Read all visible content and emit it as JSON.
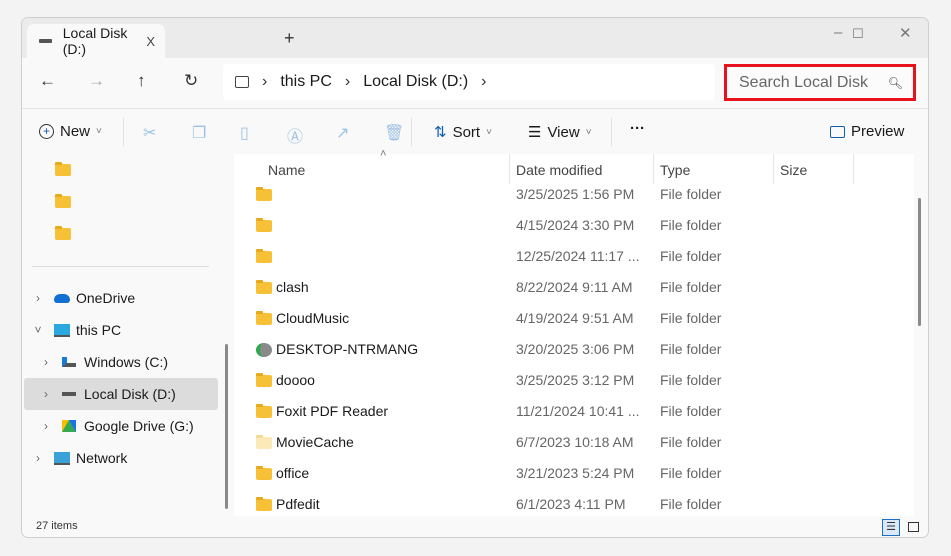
{
  "tab": {
    "title": "Local Disk (D:)",
    "close": "X",
    "new_tab": "+"
  },
  "window_controls": {
    "minimize": "–",
    "maximize": "☐",
    "close": "✕"
  },
  "nav": {
    "back": "←",
    "forward": "→",
    "up": "↑",
    "refresh": "↻"
  },
  "breadcrumb": {
    "items": [
      "this PC",
      "Local Disk (D:)"
    ],
    "sep": "›"
  },
  "search": {
    "placeholder": "Search Local Disk",
    "highlight_color": "#e8121e"
  },
  "toolbar": {
    "new": "New",
    "sort": "Sort",
    "view": "View",
    "more": "···",
    "preview": "Preview",
    "caret": "˅"
  },
  "sidebar": {
    "pinned": [
      "",
      "",
      ""
    ],
    "items": [
      {
        "label": "OneDrive",
        "icon": "onedrive-icon",
        "expanded": false
      },
      {
        "label": "this PC",
        "icon": "computer-icon",
        "expanded": true
      },
      {
        "label": "Windows (C:)",
        "icon": "windows-drive-icon",
        "expanded": false
      },
      {
        "label": "Local Disk (D:)",
        "icon": "drive-icon",
        "expanded": false,
        "selected": true
      },
      {
        "label": "Google Drive (G:)",
        "icon": "google-drive-icon",
        "expanded": false
      },
      {
        "label": "Network",
        "icon": "network-icon",
        "expanded": false
      }
    ]
  },
  "columns": {
    "name": "Name",
    "date": "Date modified",
    "type": "Type",
    "size": "Size"
  },
  "files": [
    {
      "name": "",
      "date": "3/25/2025 1:56 PM",
      "type": "File folder"
    },
    {
      "name": "",
      "date": "4/15/2024 3:30 PM",
      "type": "File folder"
    },
    {
      "name": "",
      "date": "12/25/2024 11:17 ...",
      "type": "File folder"
    },
    {
      "name": "clash",
      "date": "8/22/2024 9:11 AM",
      "type": "File folder"
    },
    {
      "name": "CloudMusic",
      "date": "4/19/2024 9:51 AM",
      "type": "File folder"
    },
    {
      "name": "DESKTOP-NTRMANG",
      "date": "3/20/2025 3:06 PM",
      "type": "File folder",
      "icon": "network-share-icon"
    },
    {
      "name": "doooo",
      "date": "3/25/2025 3:12 PM",
      "type": "File folder"
    },
    {
      "name": "Foxit PDF Reader",
      "date": "11/21/2024 10:41 ...",
      "type": "File folder"
    },
    {
      "name": "MovieCache",
      "date": "6/7/2023 10:18 AM",
      "type": "File folder",
      "icon": "hidden-folder-icon"
    },
    {
      "name": "office",
      "date": "3/21/2023 5:24 PM",
      "type": "File folder"
    },
    {
      "name": "Pdfedit",
      "date": "6/1/2023 4:11 PM",
      "type": "File folder"
    }
  ],
  "status": {
    "count": "27 items"
  }
}
